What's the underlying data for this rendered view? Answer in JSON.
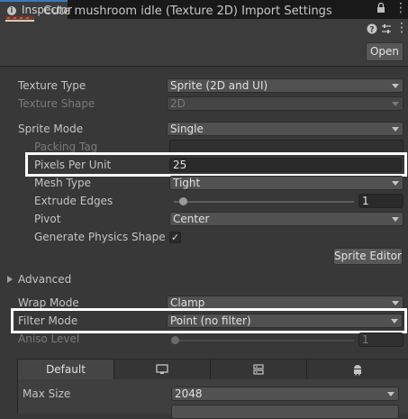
{
  "tab": {
    "label": "Inspector",
    "icon": "info-icon"
  },
  "tab_actions": {
    "lock_icon": "lock-icon",
    "menu_icon": "kebab-menu-icon"
  },
  "header": {
    "title": "Cute mushroom idle (Texture 2D) Import Settings",
    "help_icon": "help-icon",
    "presets_icon": "presets-icon",
    "menu_icon": "kebab-menu-icon",
    "open_label": "Open"
  },
  "fields": {
    "texture_type": {
      "label": "Texture Type",
      "value": "Sprite (2D and UI)"
    },
    "texture_shape": {
      "label": "Texture Shape",
      "value": "2D"
    },
    "sprite_mode": {
      "label": "Sprite Mode",
      "value": "Single"
    },
    "packing_tag": {
      "label": "Packing Tag",
      "value": ""
    },
    "pixels_per_unit": {
      "label": "Pixels Per Unit",
      "value": "25"
    },
    "mesh_type": {
      "label": "Mesh Type",
      "value": "Tight"
    },
    "extrude_edges": {
      "label": "Extrude Edges",
      "value": "1",
      "slider_fraction": 0.03
    },
    "pivot": {
      "label": "Pivot",
      "value": "Center"
    },
    "generate_physics_shape": {
      "label": "Generate Physics Shape",
      "checked": true,
      "check_glyph": "✓"
    },
    "sprite_editor_label": "Sprite Editor",
    "advanced_label": "Advanced",
    "wrap_mode": {
      "label": "Wrap Mode",
      "value": "Clamp"
    },
    "filter_mode": {
      "label": "Filter Mode",
      "value": "Point (no filter)"
    },
    "aniso_level": {
      "label": "Aniso Level",
      "value": "1",
      "slider_fraction": 0.0
    }
  },
  "platform": {
    "tabs": [
      {
        "label": "Default",
        "icon": ""
      },
      {
        "label": "",
        "icon": "monitor-icon"
      },
      {
        "label": "",
        "icon": "server-icon"
      },
      {
        "label": "",
        "icon": "android-icon"
      }
    ],
    "max_size": {
      "label": "Max Size",
      "value": "2048"
    }
  }
}
